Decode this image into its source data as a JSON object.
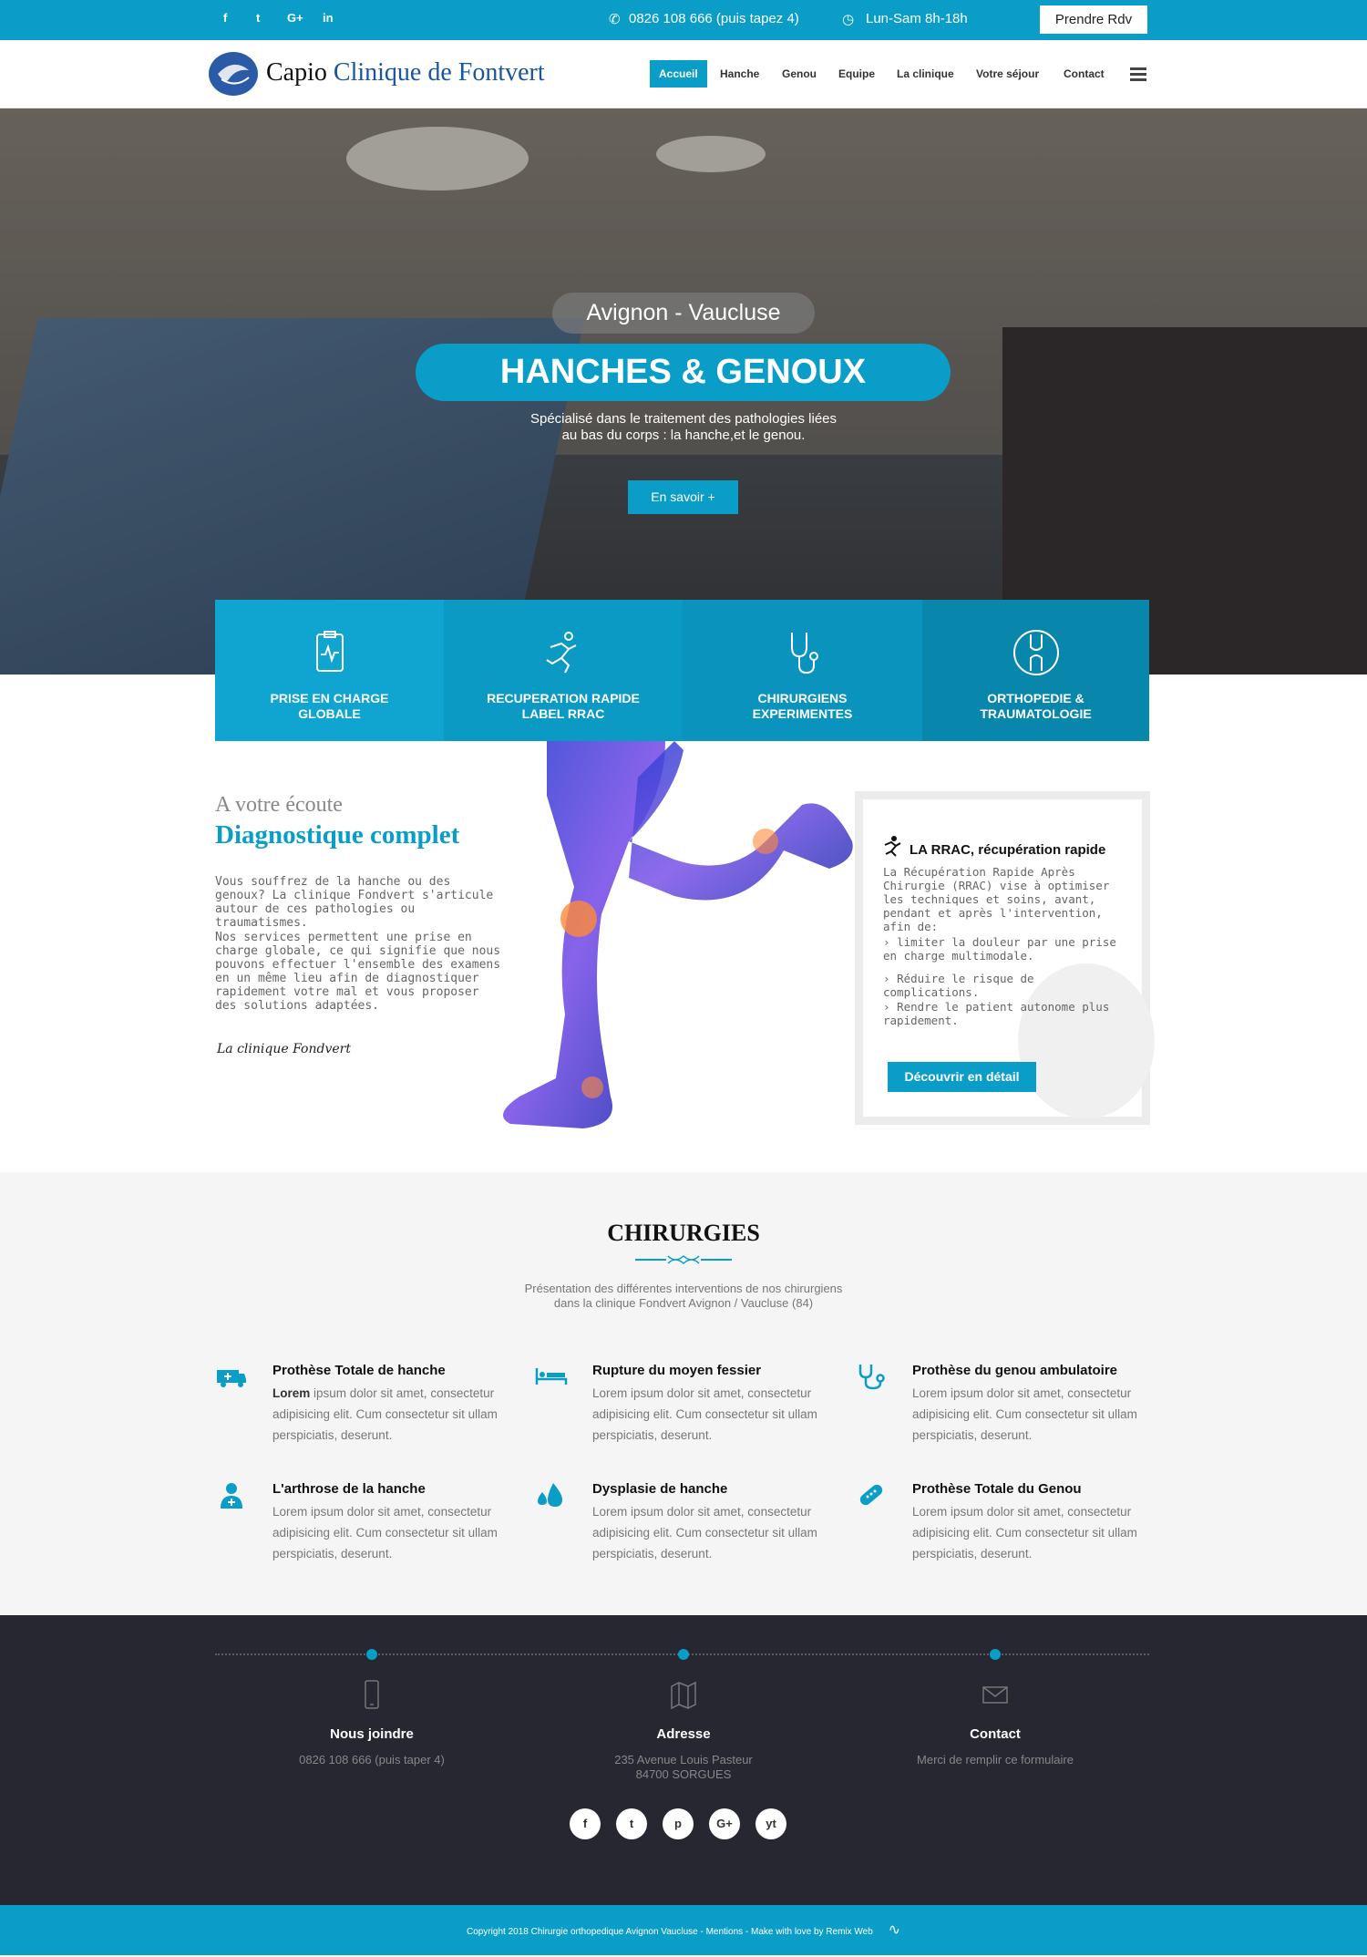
{
  "topbar": {
    "social": [
      "f",
      "t",
      "G+",
      "in"
    ],
    "phone_icon": "phone-icon",
    "phone": "0826 108 666 (puis tapez 4)",
    "clock_icon": "clock-icon",
    "hours": "Lun-Sam 8h-18h",
    "cta": "Prendre Rdv",
    "color_primary": "#0a9dc8"
  },
  "nav": {
    "logo_a": "Capio",
    "logo_b": "Clinique de Fontvert",
    "items": [
      "Accueil",
      "Hanche",
      "Genou",
      "Equipe",
      "La clinique",
      "Votre séjour",
      "Contact"
    ]
  },
  "hero": {
    "location": "Avignon - Vaucluse",
    "title": "HANCHES & GENOUX",
    "subtitle_1": "Spécialisé dans le traitement des pathologies liées",
    "subtitle_2": "au bas du corps : la hanche,et le genou.",
    "button": "En savoir +"
  },
  "features": [
    {
      "line1": "PRISE EN CHARGE",
      "line2": "GLOBALE",
      "icon": "clipboard-chart-icon"
    },
    {
      "line1": "RECUPERATION RAPIDE",
      "line2": "LABEL RRAC",
      "icon": "runner-icon"
    },
    {
      "line1": "CHIRURGIENS",
      "line2": "EXPERIMENTES",
      "icon": "stethoscope-icon"
    },
    {
      "line1": "ORTHOPEDIE &",
      "line2": "TRAUMATOLOGIE",
      "icon": "joint-icon"
    }
  ],
  "about": {
    "kicker": "A votre écoute",
    "heading": "Diagnostique complet",
    "p1": "Vous souffrez de la hanche ou des genoux? La clinique Fondvert s'articule autour de ces pathologies ou traumatismes.",
    "p2": "Nos services permettent une prise en charge globale, ce qui signifie que nous pouvons effectuer l'ensemble des examens en un même lieu afin de diagnostiquer rapidement votre mal et vous proposer des solutions adaptées.",
    "signature": "La clinique Fondvert"
  },
  "rrac": {
    "title": "LA RRAC, récupération rapide",
    "intro": "La Récupération Rapide Après Chirurgie (RRAC) vise à optimiser les techniques et soins, avant, pendant et après l'intervention, afin de:",
    "points": [
      "limiter la douleur par une prise en charge multimodale.",
      "Réduire le risque de complications.",
      "Rendre le patient autonome plus rapidement."
    ],
    "button": "Découvrir en détail"
  },
  "chirurgies": {
    "title": "CHIRURGIES",
    "intro_1": "Présentation des différentes interventions de nos chirurgiens",
    "intro_2": "dans la clinique Fondvert Avignon / Vaucluse (84)",
    "items": [
      {
        "title": "Prothèse Totale de hanche",
        "lead": "Lorem",
        "desc": " ipsum dolor sit amet, consectetur adipisicing elit. Cum consectetur sit ullam perspiciatis, deserunt.",
        "icon": "ambulance-icon"
      },
      {
        "title": "Rupture du moyen fessier",
        "lead": "",
        "desc": "Lorem ipsum dolor sit amet, consectetur adipisicing elit. Cum consectetur sit ullam perspiciatis, deserunt.",
        "icon": "hospital-bed-icon"
      },
      {
        "title": "Prothèse du genou ambulatoire",
        "lead": "",
        "desc": "Lorem ipsum dolor sit amet, consectetur adipisicing elit. Cum consectetur sit ullam perspiciatis, deserunt.",
        "icon": "stethoscope-icon"
      },
      {
        "title": "L'arthrose de la hanche",
        "lead": "",
        "desc": "Lorem ipsum dolor sit amet, consectetur adipisicing elit. Cum consectetur sit ullam perspiciatis, deserunt.",
        "icon": "doctor-icon"
      },
      {
        "title": "Dysplasie de hanche",
        "lead": "",
        "desc": "Lorem ipsum dolor sit amet, consectetur adipisicing elit. Cum consectetur sit ullam perspiciatis, deserunt.",
        "icon": "drops-icon"
      },
      {
        "title": "Prothèse Totale du Genou",
        "lead": "",
        "desc": "Lorem ipsum dolor sit amet, consectetur adipisicing elit. Cum consectetur sit ullam perspiciatis, deserunt.",
        "icon": "pill-icon"
      }
    ]
  },
  "footer": {
    "cols": [
      {
        "heading": "Nous joindre",
        "line1": "0826 108 666 (puis taper 4)",
        "line2": "",
        "icon": "mobile-icon"
      },
      {
        "heading": "Adresse",
        "line1": "235 Avenue Louis Pasteur",
        "line2": "84700 SORGUES",
        "icon": "map-icon"
      },
      {
        "heading": "Contact",
        "line1": "Merci de remplir ce formulaire",
        "line2": "",
        "icon": "envelope-icon"
      }
    ],
    "social": [
      "f",
      "t",
      "p",
      "G+",
      "yt"
    ],
    "copyright": "Copyright 2018 Chirurgie orthopedique Avignon Vaucluse - Mentions - Make with love by Remix Web"
  }
}
